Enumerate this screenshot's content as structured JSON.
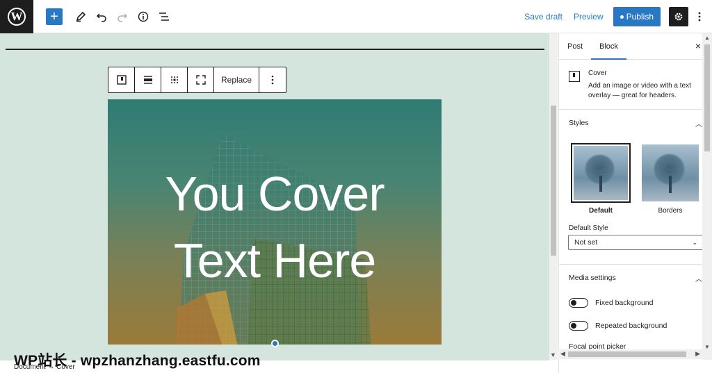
{
  "topbar": {
    "logo": "W",
    "add_icon": "+",
    "tools": [
      "pencil-icon",
      "undo-icon",
      "redo-icon",
      "info-icon",
      "list-view-icon"
    ],
    "save_draft": "Save draft",
    "preview": "Preview",
    "publish": "Publish",
    "settings_icon": "gear-icon"
  },
  "block_toolbar": {
    "replace_label": "Replace"
  },
  "cover": {
    "line1": "You Cover",
    "line2": "Text Here",
    "gradient_top": "#2f7b73",
    "gradient_bottom": "#9b7a3a"
  },
  "footer": {
    "crumb_document": "Document",
    "crumb_sep": "→",
    "crumb_cover": "Cover"
  },
  "watermark": "WP站长 - wpzhanzhang.eastfu.com",
  "sidebar": {
    "tabs": [
      "Post",
      "Block"
    ],
    "active_tab": "Block",
    "close_icon": "×",
    "block_name": "Cover",
    "block_desc": "Add an image or video with a text overlay — great for headers.",
    "styles_title": "Styles",
    "styles": [
      {
        "label": "Default",
        "selected": true
      },
      {
        "label": "Borders",
        "selected": false
      }
    ],
    "default_style_label": "Default Style",
    "default_style_value": "Not set",
    "media_title": "Media settings",
    "fixed_background": "Fixed background",
    "repeated_background": "Repeated background",
    "focal_point": "Focal point picker"
  },
  "colors": {
    "accent": "#2a78c4",
    "canvas_bg": "#d3e5dd"
  }
}
